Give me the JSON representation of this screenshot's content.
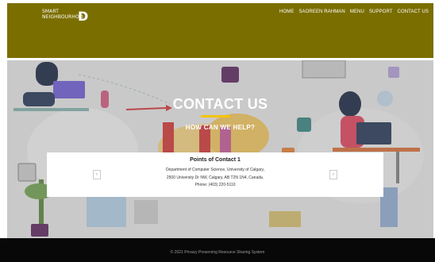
{
  "header": {
    "logo": {
      "line1": "SMART",
      "line2": "NEIGHBOURHOO",
      "final": "D"
    },
    "nav": [
      "HOME",
      "SAOREEN RAHMAN",
      "MENU",
      "SUPPORT",
      "CONTACT US"
    ]
  },
  "hero": {
    "title": "CONTACT US",
    "subtitle": "HOW CAN WE HELP?"
  },
  "contact_card": {
    "title": "Points of Contact 1",
    "line1": "Department of Computer Science, University of Calgary,",
    "line2": "2500 University Dr NW, Calgary, AB T2N 1N4, Canada.",
    "line3": "Phone: (403) 220-5110",
    "prev_glyph": "‹",
    "next_glyph": "›"
  },
  "footer": {
    "text": "© 2021 Privacy Preserving Resource Sharing System"
  },
  "colors": {
    "header_bg": "#7b6e00",
    "accent": "#f4c400",
    "footer_bg": "#080808"
  }
}
